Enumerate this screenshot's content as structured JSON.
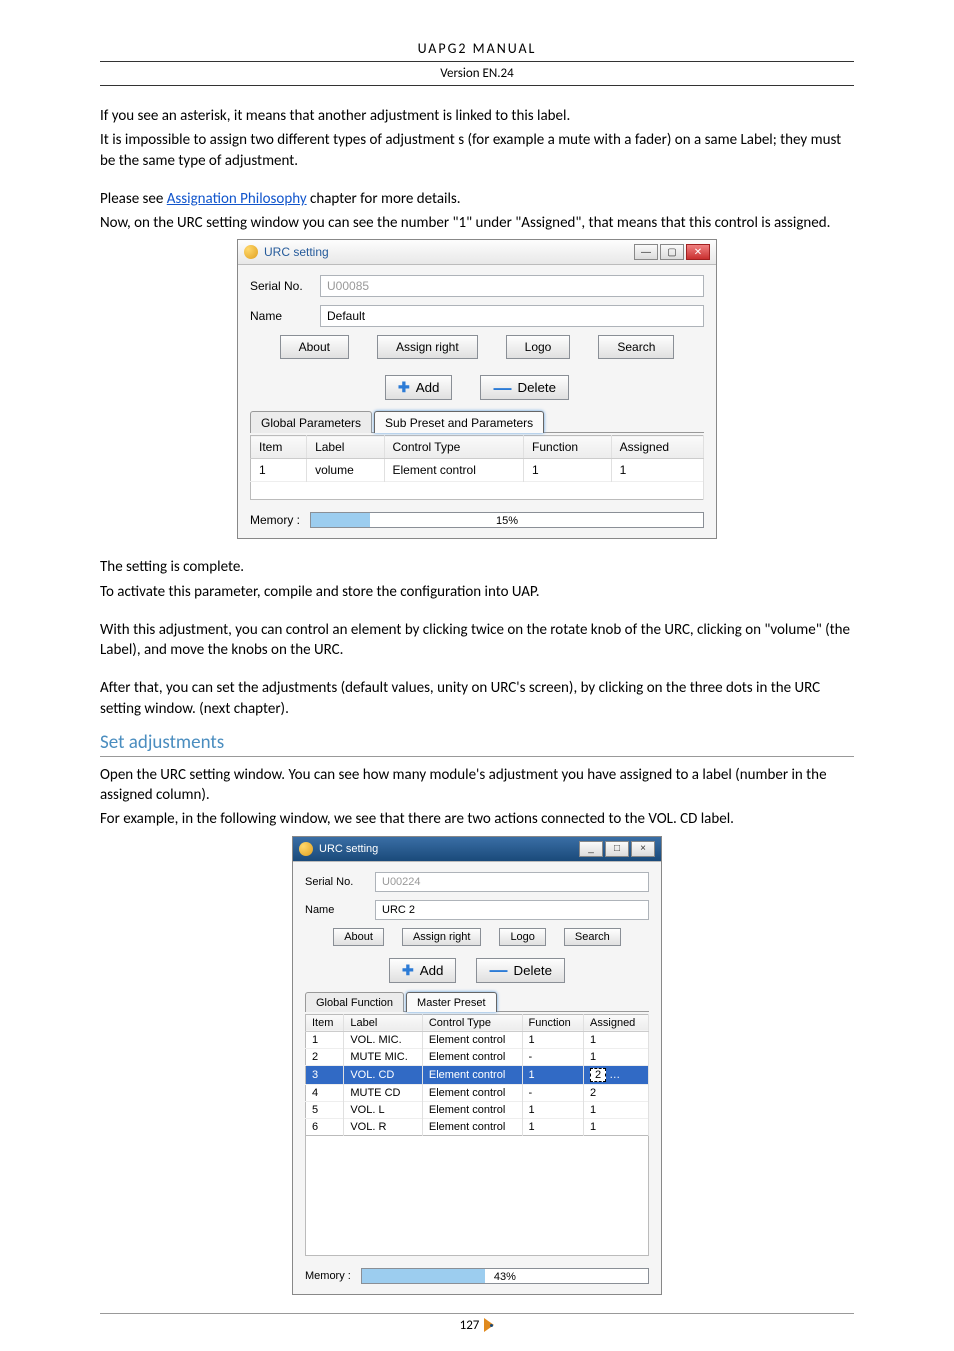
{
  "doc": {
    "header": "UAPG2  MANUAL",
    "subheader": "Version EN.24",
    "page_number": "127"
  },
  "body": {
    "p1": "If you see an asterisk, it means that another adjustment is linked to this label.",
    "p2": "It is impossible to assign two different types of adjustment s (for example a mute with a fader) on a same Label; they must be the same type of adjustment.",
    "p3_pre": "Please see ",
    "p3_link": "Assignation Philosophy",
    "p3_post": " chapter for more details.",
    "p4": "Now, on the URC setting window you can see the number \"1\" under \"Assigned\", that means that this control is assigned.",
    "p5": "The setting is complete.",
    "p6": "To activate this parameter, compile and store the configuration into UAP.",
    "p7": "With this adjustment, you can control an element by clicking twice on the rotate knob of the URC, clicking on \"volume\" (the Label), and move the knobs on the URC.",
    "p8": "After that, you can set the adjustments (default values, unity on URC's screen), by clicking on the three dots in the URC setting window. (next chapter).",
    "h2": "Set adjustments",
    "p9": "Open the URC setting window. You can see how many module's adjustment you have assigned to a label (number in the assigned column).",
    "p10": "For example, in the following window, we see that there are two actions connected to the VOL. CD label."
  },
  "win1": {
    "title": "URC setting",
    "serial_label": "Serial No.",
    "serial_value": "U00085",
    "name_label": "Name",
    "name_value": "Default",
    "buttons": {
      "about": "About",
      "assign": "Assign right",
      "logo": "Logo",
      "search": "Search"
    },
    "add": "Add",
    "delete": "Delete",
    "tabs": {
      "global": "Global Parameters",
      "sub": "Sub Preset and Parameters"
    },
    "cols": {
      "item": "Item",
      "label": "Label",
      "ctype": "Control Type",
      "func": "Function",
      "assigned": "Assigned"
    },
    "row": {
      "item": "1",
      "label": "volume",
      "ctype": "Element control",
      "func": "1",
      "assigned": "1"
    },
    "memory_label": "Memory :",
    "memory_pct": "15%"
  },
  "win2": {
    "title": "URC setting",
    "serial_label": "Serial No.",
    "serial_value": "U00224",
    "name_label": "Name",
    "name_value": "URC 2",
    "buttons": {
      "about": "About",
      "assign": "Assign right",
      "logo": "Logo",
      "search": "Search"
    },
    "add": "Add",
    "delete": "Delete",
    "tabs": {
      "global": "Global Function",
      "master": "Master Preset"
    },
    "cols": {
      "item": "Item",
      "label": "Label",
      "ctype": "Control Type",
      "func": "Function",
      "assigned": "Assigned"
    },
    "rows": [
      {
        "item": "1",
        "label": "VOL. MIC.",
        "ctype": "Element control",
        "func": "1",
        "assigned": "1"
      },
      {
        "item": "2",
        "label": "MUTE MIC.",
        "ctype": "Element control",
        "func": "-",
        "assigned": "1"
      },
      {
        "item": "3",
        "label": "VOL. CD",
        "ctype": "Element control",
        "func": "1",
        "assigned": "2",
        "selected": true
      },
      {
        "item": "4",
        "label": "MUTE CD",
        "ctype": "Element control",
        "func": "-",
        "assigned": "2"
      },
      {
        "item": "5",
        "label": "VOL. L",
        "ctype": "Element control",
        "func": "1",
        "assigned": "1"
      },
      {
        "item": "6",
        "label": "VOL. R",
        "ctype": "Element control",
        "func": "1",
        "assigned": "1"
      }
    ],
    "memory_label": "Memory :",
    "memory_pct": "43%"
  }
}
